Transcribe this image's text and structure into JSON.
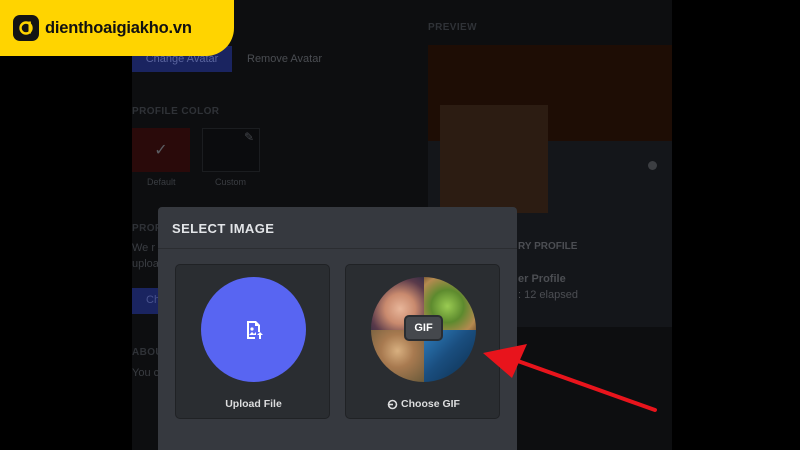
{
  "logo": {
    "text": "dienthoaigiakho.vn"
  },
  "settings": {
    "change_avatar": "Change Avatar",
    "remove_avatar": "Remove Avatar",
    "profile_color_heading": "PROFILE COLOR",
    "color_default": "Default",
    "color_custom": "Custom",
    "partial_heading_1": "PROF",
    "partial_text_1": "We r",
    "partial_text_2": "uploa",
    "partial_btn": "Ch",
    "partial_heading_2": "ABOU",
    "partial_text_3": "You c"
  },
  "preview": {
    "heading": "PREVIEW",
    "card_heading": "RY PROFILE",
    "card_title": "er Profile",
    "card_elapsed": ": 12 elapsed"
  },
  "modal": {
    "title": "SELECT IMAGE",
    "upload_label": "Upload File",
    "gif_label": "Choose GIF",
    "gif_badge": "GIF"
  },
  "colors": {
    "blurple": "#5865f2",
    "modal_bg": "#36393f",
    "logo_yellow": "#ffd400",
    "arrow_red": "#e8141c"
  }
}
